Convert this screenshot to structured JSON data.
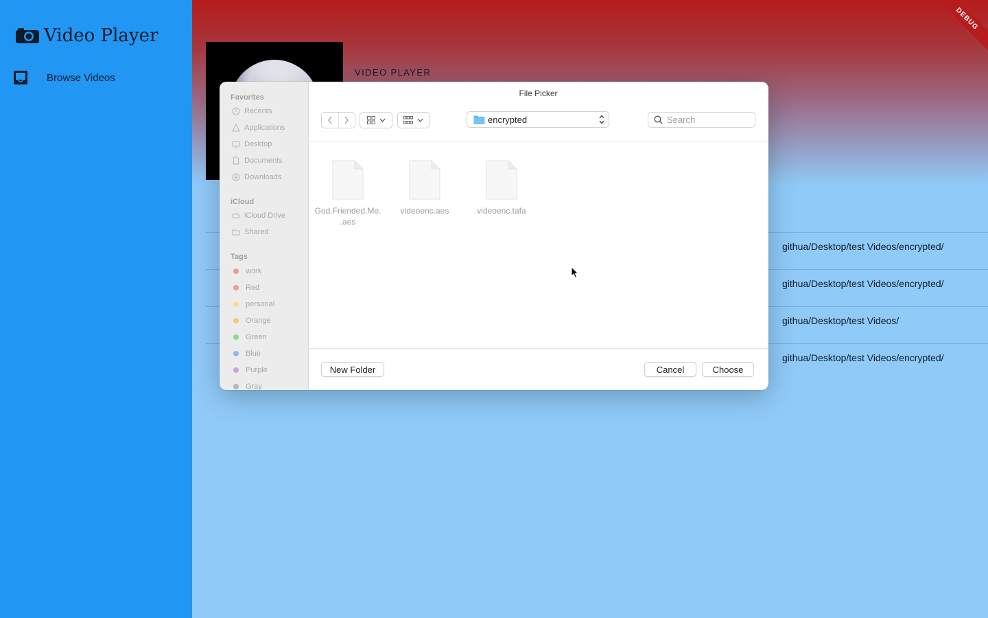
{
  "app": {
    "title": "Video Player",
    "nav_items": [
      {
        "label": "Browse Videos",
        "icon": "inbox-icon"
      }
    ]
  },
  "main": {
    "section_label": "VIDEO PLAYER",
    "rows": [
      {
        "path": "githua/Desktop/test Videos/encrypted/"
      },
      {
        "path": "githua/Desktop/test Videos/encrypted/"
      },
      {
        "path": "githua/Desktop/test Videos/"
      },
      {
        "path": "githua/Desktop/test Videos/encrypted/"
      }
    ],
    "debug_banner": "DEBUG"
  },
  "dialog": {
    "title": "File Picker",
    "sidebar": {
      "favorites_heading": "Favorites",
      "favorites": [
        {
          "label": "Recents",
          "icon": "clock-icon"
        },
        {
          "label": "Applications",
          "icon": "applications-icon"
        },
        {
          "label": "Desktop",
          "icon": "desktop-icon"
        },
        {
          "label": "Documents",
          "icon": "document-icon"
        },
        {
          "label": "Downloads",
          "icon": "download-icon"
        }
      ],
      "icloud_heading": "iCloud",
      "icloud": [
        {
          "label": "iCloud Drive",
          "icon": "cloud-icon"
        },
        {
          "label": "Shared",
          "icon": "shared-folder-icon"
        }
      ],
      "tags_heading": "Tags",
      "tags": [
        {
          "label": "work",
          "color": "#ef9a9a"
        },
        {
          "label": "Red",
          "color": "#ef9a9a"
        },
        {
          "label": "personal",
          "color": "#f5e08f"
        },
        {
          "label": "Orange",
          "color": "#f5c77e"
        },
        {
          "label": "Green",
          "color": "#8fd68f"
        },
        {
          "label": "Blue",
          "color": "#8fb7ef"
        },
        {
          "label": "Purple",
          "color": "#cfa3e0"
        },
        {
          "label": "Gray",
          "color": "#b8b8b8"
        }
      ]
    },
    "toolbar": {
      "current_folder": "encrypted",
      "search_placeholder": "Search"
    },
    "files": [
      {
        "name": "God.Friended.Me.\n.aes"
      },
      {
        "name": "videoenc.aes"
      },
      {
        "name": "videoenc.tafa"
      }
    ],
    "buttons": {
      "new_folder": "New Folder",
      "cancel": "Cancel",
      "choose": "Choose"
    }
  }
}
